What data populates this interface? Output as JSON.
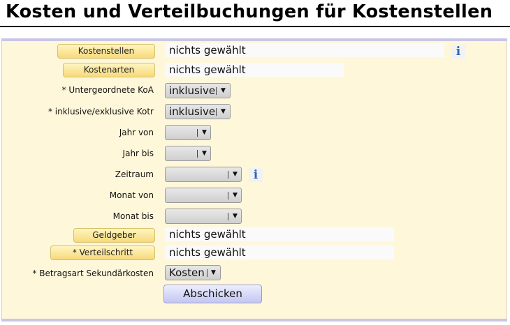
{
  "page": {
    "title": "Kosten und Verteilbuchungen für Kostenstellen"
  },
  "form": {
    "kostenstellen": {
      "button": "Kostenstellen",
      "value": "nichts gewählt"
    },
    "kostenarten": {
      "button": "Kostenarten",
      "value": "nichts gewählt"
    },
    "untergeordnete_koa": {
      "label": "* Untergeordnete KoA",
      "selected": "inklusive"
    },
    "inkl_exkl_kotr": {
      "label": "* inklusive/exklusive Kotr",
      "selected": "inklusive"
    },
    "jahr_von": {
      "label": "Jahr von",
      "selected": ""
    },
    "jahr_bis": {
      "label": "Jahr bis",
      "selected": ""
    },
    "zeitraum": {
      "label": "Zeitraum",
      "selected": ""
    },
    "monat_von": {
      "label": "Monat von",
      "selected": ""
    },
    "monat_bis": {
      "label": "Monat bis",
      "selected": ""
    },
    "geldgeber": {
      "button": "Geldgeber",
      "value": "nichts gewählt"
    },
    "verteilschritt": {
      "button": "* Verteilschritt",
      "value": "nichts gewählt"
    },
    "betragsart": {
      "label": "* Betragsart Sekundärkosten",
      "selected": "Kosten"
    },
    "submit_label": "Abschicken",
    "info_glyph": "i"
  },
  "icons": {
    "info": "info-icon",
    "dropdown": "chevron-down-icon"
  },
  "colors": {
    "panel_bg": "#fff7da",
    "panel_border": "#c9c6e6",
    "lookup_button": "#f7d97a",
    "submit_button": "#c4c6f0",
    "info_icon": "#2a66b8"
  }
}
